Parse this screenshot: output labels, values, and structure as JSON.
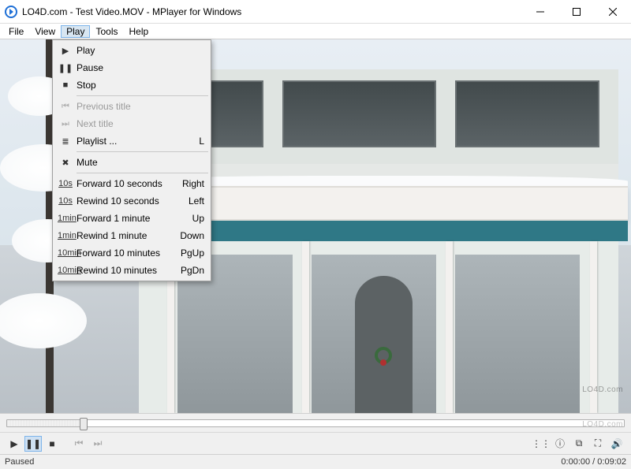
{
  "window": {
    "title": "LO4D.com - Test Video.MOV - MPlayer for Windows"
  },
  "menubar": {
    "items": [
      "File",
      "View",
      "Play",
      "Tools",
      "Help"
    ],
    "active_index": 2
  },
  "play_menu": {
    "groups": [
      [
        {
          "icon": "▶",
          "label": "Play",
          "shortcut": "",
          "disabled": false
        },
        {
          "icon": "❚❚",
          "label": "Pause",
          "shortcut": "",
          "disabled": false
        },
        {
          "icon": "■",
          "label": "Stop",
          "shortcut": "",
          "disabled": false
        }
      ],
      [
        {
          "icon": "⏮",
          "label": "Previous title",
          "shortcut": "",
          "disabled": true
        },
        {
          "icon": "⏭",
          "label": "Next title",
          "shortcut": "",
          "disabled": true
        },
        {
          "icon": "≣",
          "label": "Playlist ...",
          "shortcut": "L",
          "disabled": false
        }
      ],
      [
        {
          "icon": "✖",
          "label": "Mute",
          "shortcut": "",
          "disabled": false
        }
      ],
      [
        {
          "icon": "10s→",
          "label": "Forward 10 seconds",
          "shortcut": "Right",
          "disabled": false,
          "small": true
        },
        {
          "icon": "←10s",
          "label": "Rewind 10 seconds",
          "shortcut": "Left",
          "disabled": false,
          "small": true
        },
        {
          "icon": "1min→",
          "label": "Forward 1 minute",
          "shortcut": "Up",
          "disabled": false,
          "small": true
        },
        {
          "icon": "←1min",
          "label": "Rewind 1 minute",
          "shortcut": "Down",
          "disabled": false,
          "small": true
        },
        {
          "icon": "10min→",
          "label": "Forward 10 minutes",
          "shortcut": "PgUp",
          "disabled": false,
          "small": true
        },
        {
          "icon": "←10min",
          "label": "Rewind 10 minutes",
          "shortcut": "PgDn",
          "disabled": false,
          "small": true
        }
      ]
    ]
  },
  "status": {
    "state": "Paused",
    "time": "0:00:00 / 0:09:02"
  },
  "watermark": "LO4D.com"
}
